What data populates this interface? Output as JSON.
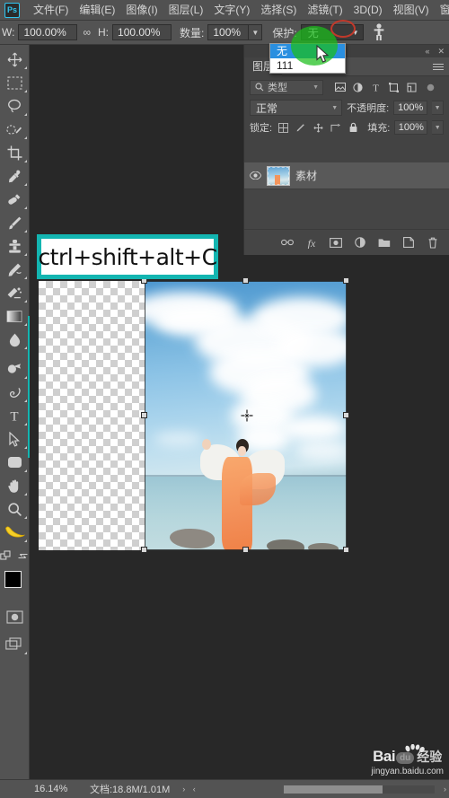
{
  "app": {
    "logo": "Ps"
  },
  "menubar": {
    "items": [
      {
        "label": "文件(F)",
        "name": "menu-file"
      },
      {
        "label": "编辑(E)",
        "name": "menu-edit"
      },
      {
        "label": "图像(I)",
        "name": "menu-image"
      },
      {
        "label": "图层(L)",
        "name": "menu-layer"
      },
      {
        "label": "文字(Y)",
        "name": "menu-type"
      },
      {
        "label": "选择(S)",
        "name": "menu-select"
      },
      {
        "label": "滤镜(T)",
        "name": "menu-filter"
      },
      {
        "label": "3D(D)",
        "name": "menu-3d"
      },
      {
        "label": "视图(V)",
        "name": "menu-view"
      },
      {
        "label": "窗口(W)",
        "name": "menu-window"
      }
    ]
  },
  "options_bar": {
    "width_label": "W:",
    "width_value": "100.00%",
    "link_icon": "chain-link-icon",
    "height_label": "H:",
    "height_value": "100.00%",
    "amount_label": "数量:",
    "amount_value": "100%",
    "protect_label": "保护:",
    "protect_value": "无",
    "person_icon": "person-icon"
  },
  "protect_dropdown": {
    "open": true,
    "options": [
      {
        "label": "无",
        "selected": true
      },
      {
        "label": "111",
        "selected": false
      }
    ]
  },
  "annotations": {
    "green_blob_color": "#1abe1a",
    "red_circle_color": "#c0392b",
    "highlight_box_border": "#13b5b1",
    "shortcut_text": "ctrl+shift+alt+C"
  },
  "toolbar": {
    "tools": [
      {
        "name": "move-tool",
        "icon": "move-icon"
      },
      {
        "name": "rectangular-marquee-tool",
        "icon": "marquee-icon"
      },
      {
        "name": "lasso-tool",
        "icon": "lasso-icon"
      },
      {
        "name": "quick-selection-tool",
        "icon": "quick-select-icon"
      },
      {
        "name": "crop-tool",
        "icon": "crop-icon"
      },
      {
        "name": "eyedropper-tool",
        "icon": "eyedropper-icon"
      },
      {
        "name": "spot-healing-brush-tool",
        "icon": "healing-brush-icon"
      },
      {
        "name": "brush-tool",
        "icon": "brush-icon"
      },
      {
        "name": "clone-stamp-tool",
        "icon": "stamp-icon"
      },
      {
        "name": "history-brush-tool",
        "icon": "history-brush-icon"
      },
      {
        "name": "eraser-tool",
        "icon": "eraser-icon"
      },
      {
        "name": "gradient-tool",
        "icon": "gradient-icon"
      },
      {
        "name": "blur-tool",
        "icon": "blur-drop-icon"
      },
      {
        "name": "dodge-tool",
        "icon": "dodge-icon"
      },
      {
        "name": "pen-tool",
        "icon": "pen-icon"
      },
      {
        "name": "horizontal-type-tool",
        "icon": "type-t-icon"
      },
      {
        "name": "path-selection-tool",
        "icon": "arrow-pointer-icon"
      },
      {
        "name": "rounded-rectangle-tool",
        "icon": "rounded-rect-icon"
      },
      {
        "name": "hand-tool",
        "icon": "hand-icon"
      },
      {
        "name": "zoom-tool",
        "icon": "magnifier-icon"
      },
      {
        "name": "custom-banana-tool",
        "icon": "banana-icon"
      },
      {
        "name": "edit-toolbar-tool",
        "icon": "more-dots-icon"
      }
    ],
    "foreground_color": "#000000",
    "background_color": "#ffffff",
    "quick_mask_icon": "quick-mask-icon",
    "screen-mode_icon": "screen-mode-icon"
  },
  "layers_panel": {
    "tab_label": "图层",
    "collapse_icon": "collapse-icon",
    "close_icon": "close-icon",
    "menu_icon": "panel-menu-icon",
    "filter_label": "类型",
    "filter_search_icon": "search-icon",
    "filter_icons": [
      "pixel-layer-filter-icon",
      "adjustment-layer-filter-icon",
      "type-layer-filter-icon",
      "shape-layer-filter-icon",
      "smart-object-filter-icon"
    ],
    "filter_toggle_icon": "filter-power-toggle-icon",
    "blend_mode": "正常",
    "opacity_label": "不透明度:",
    "opacity_value": "100%",
    "lock_label": "锁定:",
    "lock_icons": [
      "lock-transparent-pixels-icon",
      "lock-image-pixels-icon",
      "lock-position-icon",
      "lock-artboard-nesting-icon",
      "lock-all-icon"
    ],
    "fill_label": "填充:",
    "fill_value": "100%",
    "layers": [
      {
        "name": "素材",
        "visible": true,
        "visibility_icon": "eye-icon"
      }
    ],
    "bottom_icons": [
      "link-layers-icon",
      "layer-style-fx-icon",
      "add-layer-mask-icon",
      "new-adjustment-layer-icon",
      "new-group-icon",
      "new-layer-icon",
      "delete-layer-icon"
    ]
  },
  "statusbar": {
    "zoom": "16.14%",
    "doc_info": "文档:18.8M/1.01M",
    "arrows": "› ‹",
    "right_caret": "›"
  },
  "watermark": {
    "bai": "Bai",
    "du": "du",
    "jingyan": "经验",
    "url": "jingyan.baidu.com"
  },
  "canvas": {
    "background_color": "#282828",
    "transform_active": true,
    "reference_point_icon": "transform-reference-point-icon"
  }
}
